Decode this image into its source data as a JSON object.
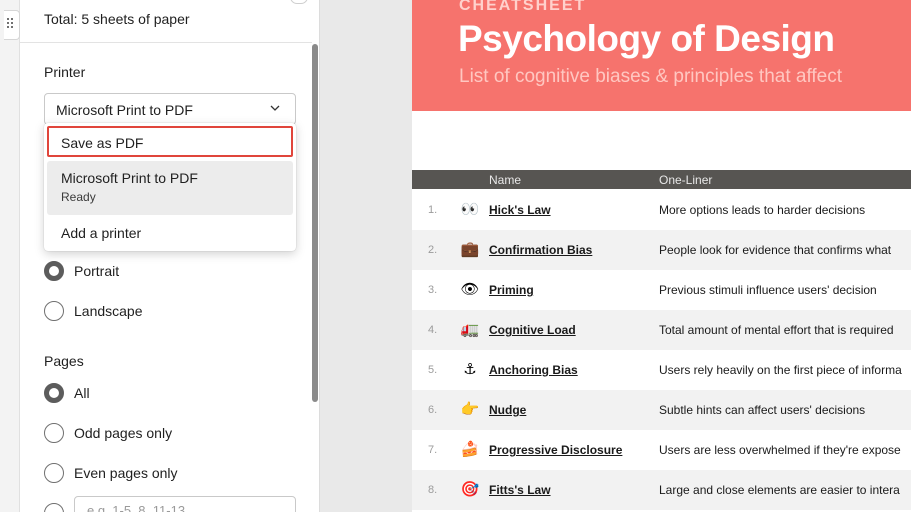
{
  "panel": {
    "total_text": "Total: 5 sheets of paper",
    "printer_heading": "Printer",
    "printer_selected": "Microsoft Print to PDF",
    "dropdown": {
      "save_as_pdf": "Save as PDF",
      "ms_print": "Microsoft Print to PDF",
      "ms_print_status": "Ready",
      "add_printer": "Add a printer"
    },
    "layout": {
      "portrait": "Portrait",
      "landscape": "Landscape",
      "selected": "Portrait"
    },
    "pages": {
      "heading": "Pages",
      "all": "All",
      "odd": "Odd pages only",
      "even": "Even pages only",
      "custom_placeholder": "e.g. 1-5, 8, 11-13",
      "selected": "All"
    }
  },
  "preview": {
    "kicker": "CHEATSHEET",
    "title": "Psychology of Design",
    "subtitle": "List of cognitive biases & principles that affect",
    "columns": {
      "name": "Name",
      "one_liner": "One-Liner"
    },
    "rows": [
      {
        "num": "1.",
        "icon": "👀",
        "name": "Hick's Law",
        "desc": "More options leads to harder decisions"
      },
      {
        "num": "2.",
        "icon": "💼",
        "name": "Confirmation Bias",
        "desc": "People look for evidence that confirms what"
      },
      {
        "num": "3.",
        "icon": "👁",
        "name": "Priming",
        "desc": "Previous stimuli influence users' decision"
      },
      {
        "num": "4.",
        "icon": "🚛",
        "name": "Cognitive Load",
        "desc": "Total amount of mental effort that is required"
      },
      {
        "num": "5.",
        "icon": "⚓",
        "name": "Anchoring Bias",
        "desc": "Users rely heavily on the first piece of informa"
      },
      {
        "num": "6.",
        "icon": "👉",
        "name": "Nudge",
        "desc": "Subtle hints can affect users' decisions"
      },
      {
        "num": "7.",
        "icon": "🍰",
        "name": "Progressive Disclosure",
        "desc": "Users are less overwhelmed if they're expose"
      },
      {
        "num": "8.",
        "icon": "🎯",
        "name": "Fitts's Law",
        "desc": "Large and close elements are easier to intera"
      }
    ]
  },
  "colors": {
    "banner": "#f6736d",
    "highlight_border": "#e0453b",
    "table_header": "#575552"
  }
}
